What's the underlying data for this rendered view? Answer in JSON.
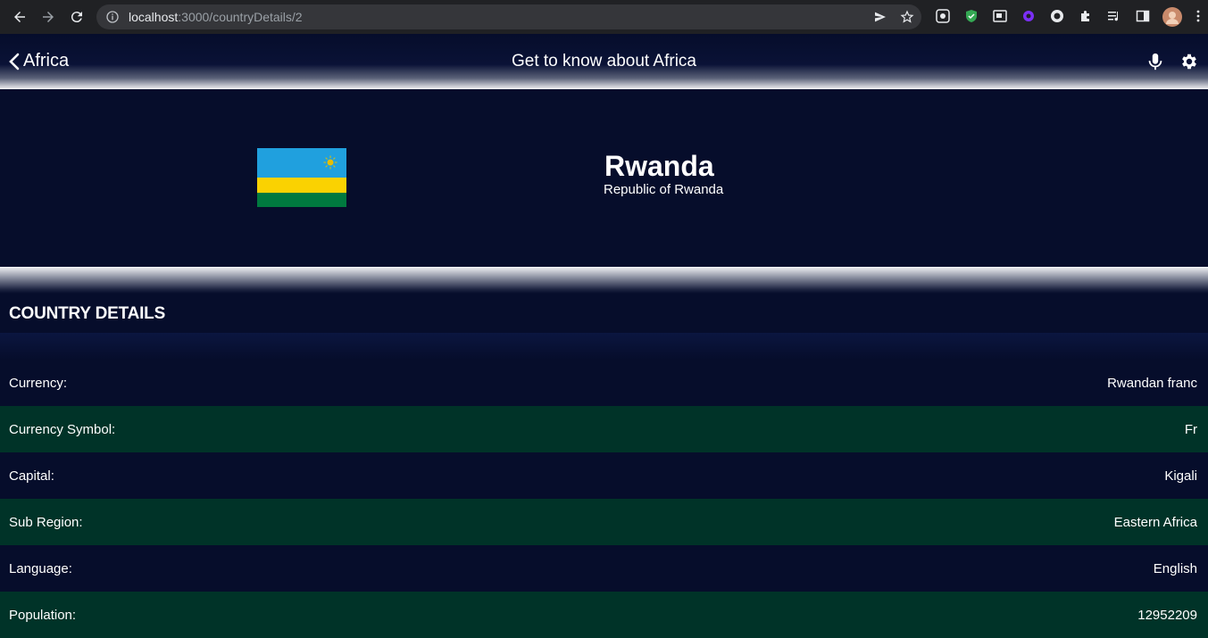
{
  "browser": {
    "url_host": "localhost",
    "url_path": ":3000/countryDetails/2"
  },
  "header": {
    "back_label": "Africa",
    "title": "Get to know about Africa"
  },
  "country": {
    "name": "Rwanda",
    "official_name": "Republic of Rwanda",
    "flag_colors": [
      "#20a0de",
      "#fad201",
      "#00793f"
    ]
  },
  "details": {
    "section_title": "COUNTRY DETAILS",
    "rows": [
      {
        "label": "Currency:",
        "value": "Rwandan franc"
      },
      {
        "label": "Currency Symbol:",
        "value": "Fr"
      },
      {
        "label": "Capital:",
        "value": "Kigali"
      },
      {
        "label": "Sub Region:",
        "value": "Eastern Africa"
      },
      {
        "label": "Language:",
        "value": "English"
      },
      {
        "label": "Population:",
        "value": "12952209"
      }
    ]
  },
  "colors": {
    "background": "#060d2b",
    "row_alt": "#003328"
  }
}
